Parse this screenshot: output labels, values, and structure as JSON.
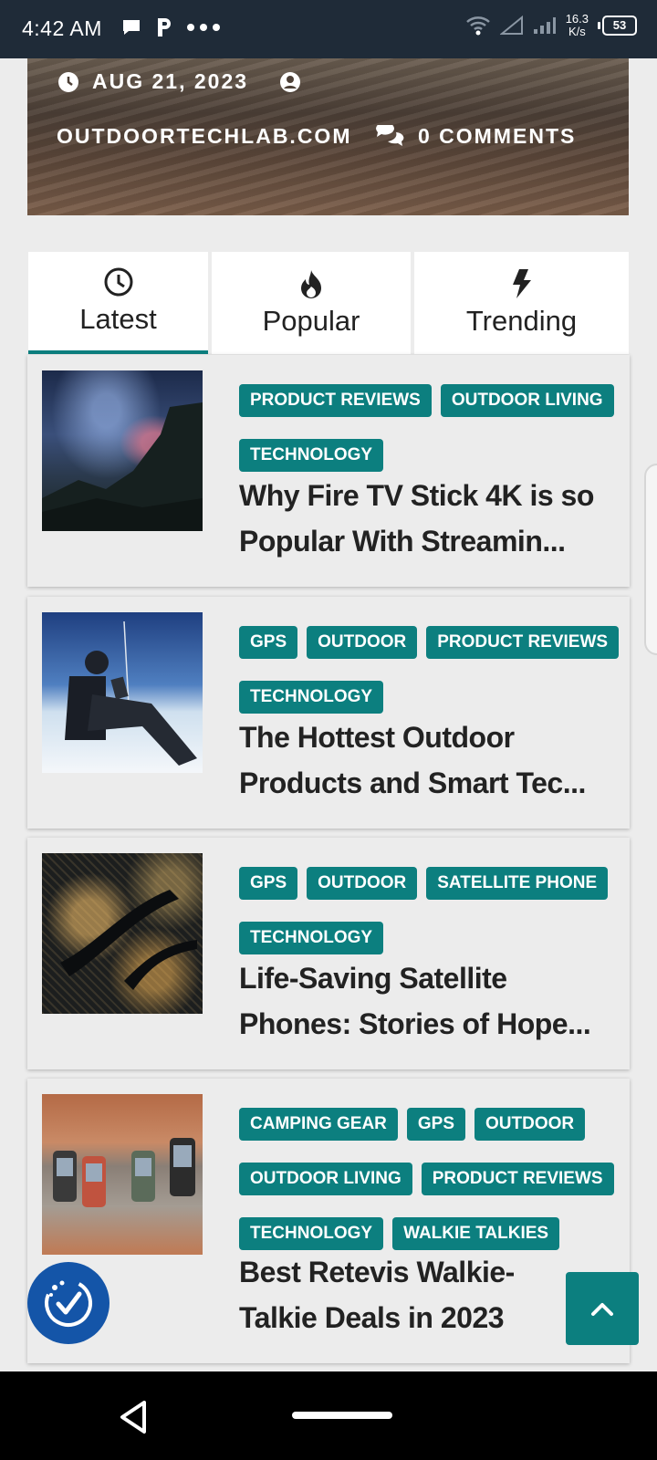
{
  "status_bar": {
    "time": "4:42 AM",
    "left_icons": [
      "chat-bubble-icon",
      "parking-p-icon",
      "more-dots-icon"
    ],
    "speed_value": "16.3",
    "speed_unit": "K/s",
    "battery": "53",
    "right_icons": [
      "wifi-icon",
      "signal-icon",
      "signal-icon-2"
    ]
  },
  "hero": {
    "date": "AUG 21, 2023",
    "author": "OUTDOORTECHLAB.COM",
    "comments": "0 COMMENTS"
  },
  "tabs": [
    {
      "label": "Latest",
      "icon": "clock-icon",
      "active": true
    },
    {
      "label": "Popular",
      "icon": "fire-icon",
      "active": false
    },
    {
      "label": "Trending",
      "icon": "bolt-icon",
      "active": false
    }
  ],
  "posts": [
    {
      "tags": [
        "PRODUCT REVIEWS",
        "OUTDOOR LIVING",
        "TECHNOLOGY"
      ],
      "title_line1": "Why Fire TV Stick 4K is so",
      "title_line2": "Popular With Streamin...",
      "thumb": "night-sky-landscape"
    },
    {
      "tags": [
        "GPS",
        "OUTDOOR",
        "PRODUCT REVIEWS",
        "TECHNOLOGY"
      ],
      "title_line1": "The Hottest Outdoor",
      "title_line2": "Products and Smart Tec...",
      "thumb": "mountain-climber-with-device"
    },
    {
      "tags": [
        "GPS",
        "OUTDOOR",
        "SATELLITE PHONE",
        "TECHNOLOGY"
      ],
      "title_line1": "Life-Saving Satellite",
      "title_line2": "Phones: Stories of Hope...",
      "thumb": "city-lights-from-space"
    },
    {
      "tags": [
        "CAMPING GEAR",
        "GPS",
        "OUTDOOR",
        "OUTDOOR LIVING",
        "PRODUCT REVIEWS",
        "TECHNOLOGY",
        "WALKIE TALKIES"
      ],
      "title_line1": "Best Retevis Walkie-",
      "title_line2": "Talkie Deals in 2023",
      "thumb": "handheld-gps-devices-on-wood"
    }
  ],
  "colors": {
    "accent": "#0c7f7f",
    "status_bar": "#1f2b38",
    "accessibility": "#1455a8"
  }
}
